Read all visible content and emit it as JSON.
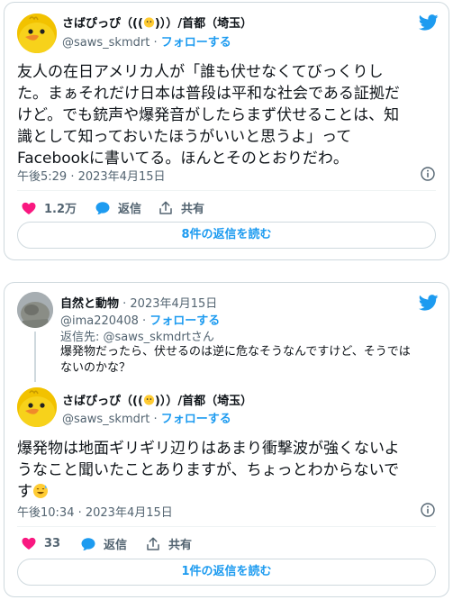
{
  "tweet1": {
    "display_name": "さばぴっぴ（((",
    "display_name_tail": ")））/首都（埼玉）",
    "handle": "@saws_skmdrt",
    "separator": " · ",
    "follow_label": "フォローする",
    "body_lines": [
      "友人の在日アメリカ人が「誰も伏せなくてびっくりし",
      "た。まぁそれだけ日本は普段は平和な社会である証拠だ",
      "けど。でも銃声や爆発音がしたらまず伏せることは、知",
      "識として知っておいたほうがいいと思うよ」って",
      "Facebookに書いてる。ほんとそのとおりだわ。"
    ],
    "timestamp": "午後5:29 · 2023年4月15日",
    "like_count": "1.2万",
    "reply_label": "返信",
    "share_label": "共有",
    "read_replies_label": "8件の返信を読む"
  },
  "tweet2": {
    "parent": {
      "display_name": "自然と動物",
      "date": " · 2023年4月15日",
      "handle": "@ima220408",
      "separator": " · ",
      "follow_label": "フォローする",
      "replying_to": "返信先: @saws_skmdrtさん",
      "body_lines": [
        "爆発物だったら、伏せるのは逆に危なそうなんですけど、そうでは",
        "ないのかな？"
      ]
    },
    "reply": {
      "display_name": "さばぴっぴ（((",
      "display_name_tail": ")））/首都（埼玉）",
      "handle": "@saws_skmdrt",
      "separator": " · ",
      "follow_label": "フォローする",
      "body_lines": [
        "爆発物は地面ギリギリ辺りはあまり衝撃波が強くないよ",
        "うなこと聞いたことありますが、ちょっとわからないで",
        "す"
      ],
      "timestamp": "午後10:34 · 2023年4月15日",
      "like_count": "33",
      "reply_label": "返信",
      "share_label": "共有",
      "read_replies_label": "1件の返信を読む"
    }
  },
  "colors": {
    "accent": "#1d9bf0",
    "like": "#f91880",
    "text": "#0f1419",
    "muted": "#536471",
    "border": "#cfd9de"
  },
  "icons": [
    "chick-avatar",
    "twitter-bird-icon",
    "info-icon",
    "heart-icon",
    "reply-bubble-icon",
    "share-icon",
    "sweat-smile-emoji",
    "chick-emoji"
  ]
}
